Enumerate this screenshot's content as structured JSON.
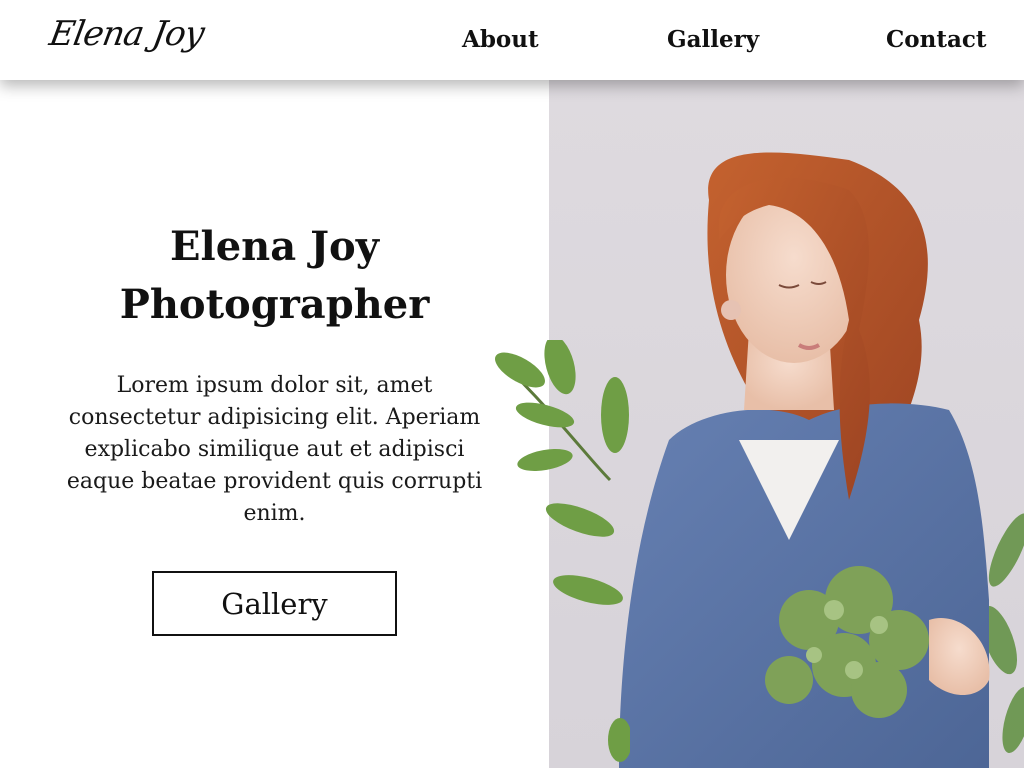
{
  "header": {
    "logo": "Elena Joy",
    "nav": [
      {
        "label": "About"
      },
      {
        "label": "Gallery"
      },
      {
        "label": "Contact"
      }
    ]
  },
  "hero": {
    "title_line1": "Elena Joy",
    "title_line2": "Photographer",
    "description": "Lorem ipsum dolor sit, amet consectetur adipisicing elit. Aperiam explicabo similique aut et adipisci eaque beatae provident quis corrupti enim.",
    "button_label": "Gallery"
  },
  "colors": {
    "background": "#ffffff",
    "text": "#111111",
    "photo_background": "#dcd8dd",
    "sweater": "#5a72a3",
    "hair": "#b5512a",
    "foliage": "#6e9a4a"
  }
}
